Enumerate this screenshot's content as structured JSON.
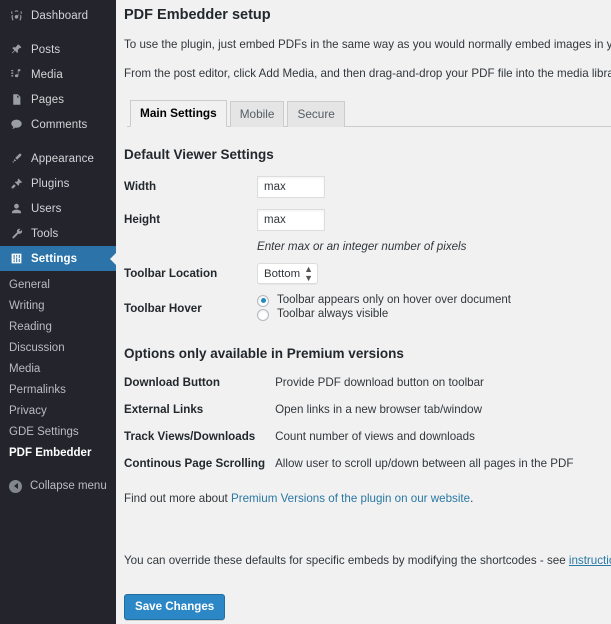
{
  "sidebar": {
    "items": [
      {
        "label": "Dashboard",
        "icon": "dashboard-icon",
        "gap_after": true
      },
      {
        "label": "Posts",
        "icon": "posts-pin-icon",
        "gap_after": false
      },
      {
        "label": "Media",
        "icon": "media-icon",
        "gap_after": false
      },
      {
        "label": "Pages",
        "icon": "pages-icon",
        "gap_after": false
      },
      {
        "label": "Comments",
        "icon": "comments-icon",
        "gap_after": true
      },
      {
        "label": "Appearance",
        "icon": "appearance-brush-icon",
        "gap_after": false
      },
      {
        "label": "Plugins",
        "icon": "plugins-icon",
        "gap_after": false
      },
      {
        "label": "Users",
        "icon": "users-icon",
        "gap_after": false
      },
      {
        "label": "Tools",
        "icon": "tools-wrench-icon",
        "gap_after": false
      },
      {
        "label": "Settings",
        "icon": "settings-sliders-icon",
        "gap_after": false,
        "active": true
      }
    ],
    "submenu": [
      {
        "label": "General"
      },
      {
        "label": "Writing"
      },
      {
        "label": "Reading"
      },
      {
        "label": "Discussion"
      },
      {
        "label": "Media"
      },
      {
        "label": "Permalinks"
      },
      {
        "label": "Privacy"
      },
      {
        "label": "GDE Settings"
      },
      {
        "label": "PDF Embedder",
        "current": true
      }
    ],
    "collapse_label": "Collapse menu",
    "active_color": "#2b73a8",
    "background_color": "#23242c"
  },
  "main": {
    "page_title": "PDF Embedder setup",
    "intro_paragraphs": [
      "To use the plugin, just embed PDFs in the same way as you would normally embed images in your posts/p",
      "From the post editor, click Add Media, and then drag-and-drop your PDF file into the media library. When"
    ],
    "tabs": [
      {
        "label": "Main Settings",
        "active": true
      },
      {
        "label": "Mobile",
        "active": false
      },
      {
        "label": "Secure",
        "active": false
      }
    ],
    "viewer_settings": {
      "title": "Default Viewer Settings",
      "width_label": "Width",
      "width_value": "max",
      "height_label": "Height",
      "height_value": "max",
      "size_hint": "Enter max or an integer number of pixels",
      "toolbar_location_label": "Toolbar Location",
      "toolbar_location_value": "Bottom",
      "toolbar_hover_label": "Toolbar Hover",
      "hover_option_1": "Toolbar appears only on hover over document",
      "hover_option_2": "Toolbar always visible",
      "hover_selected_index": 0
    },
    "premium": {
      "title": "Options only available in Premium versions",
      "rows": [
        {
          "label": "Download Button",
          "description": "Provide PDF download button on toolbar"
        },
        {
          "label": "External Links",
          "description": "Open links in a new browser tab/window"
        },
        {
          "label": "Track Views/Downloads",
          "description": "Count number of views and downloads"
        },
        {
          "label": "Continous Page Scrolling",
          "description": "Allow user to scroll up/down between all pages in the PDF"
        }
      ],
      "find_out_prefix": "Find out more about ",
      "find_out_link": "Premium Versions of the plugin on our website",
      "find_out_suffix": "."
    },
    "override_note_prefix": "You can override these defaults for specific embeds by modifying the shortcodes - see ",
    "override_note_link": "instructions",
    "override_note_suffix": ".",
    "save_button_label": "Save Changes",
    "link_color": "#2a78a4",
    "button_color": "#2b87c6"
  }
}
